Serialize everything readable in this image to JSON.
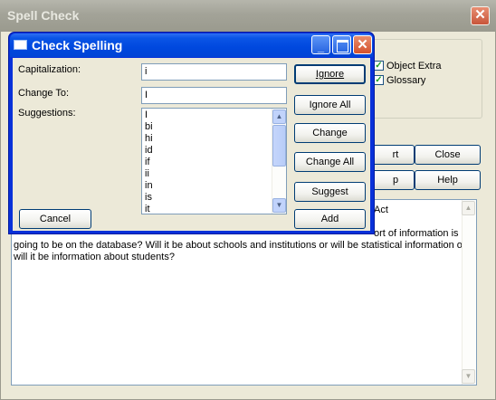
{
  "outer_window": {
    "title": "Spell Check",
    "checkboxes": [
      {
        "label": "Object Extra",
        "checked": true
      },
      {
        "label": "Glossary",
        "checked": true
      }
    ],
    "buttons": {
      "close": "Close",
      "help": "Help"
    },
    "text_fragments": {
      "act": "Act",
      "line_1_tail": "ort of information is",
      "line_2": "going to be on the database? Will it be about schools and institutions or will be statistical information or",
      "line_3": "will it be information about students?"
    }
  },
  "dialog": {
    "title": "Check Spelling",
    "labels": {
      "capitalization": "Capitalization:",
      "change_to": "Change To:",
      "suggestions": "Suggestions:"
    },
    "fields": {
      "capitalization_value": "i",
      "change_to_value": "I"
    },
    "suggestions": [
      "I",
      "bi",
      "hi",
      "id",
      "if",
      "ii",
      "in",
      "is",
      "it"
    ],
    "buttons": {
      "ignore": "Ignore",
      "ignore_all": "Ignore All",
      "change": "Change",
      "change_all": "Change All",
      "suggest": "Suggest",
      "add": "Add",
      "cancel": "Cancel"
    }
  },
  "colors": {
    "xp_blue_title": "#0a55e6",
    "xp_face": "#ece9d8",
    "inactive_title": "#a3a398"
  }
}
